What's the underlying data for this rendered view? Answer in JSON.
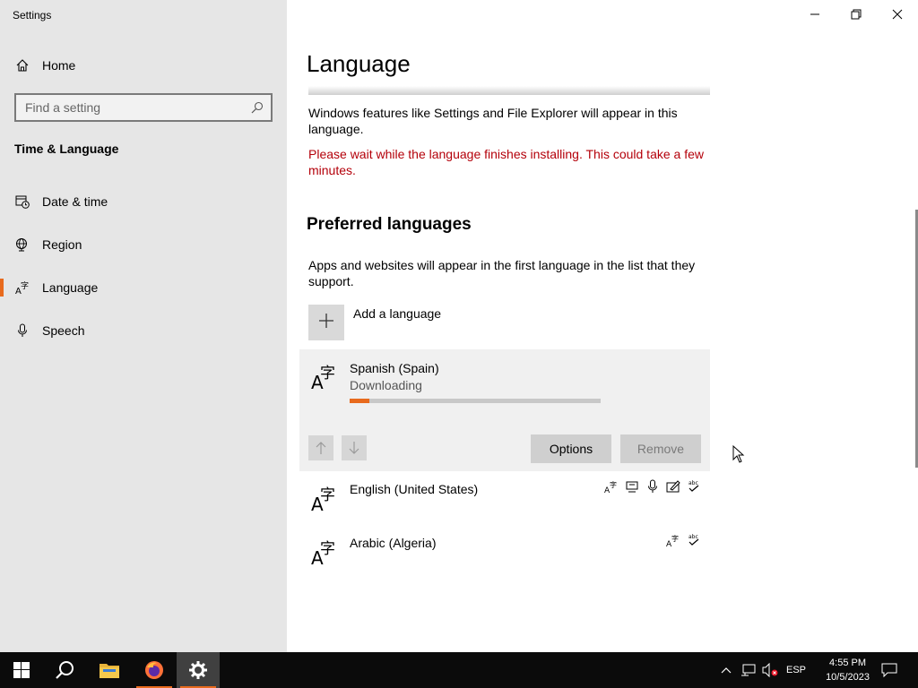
{
  "window": {
    "title": "Settings",
    "controls": [
      "minimize",
      "maximize",
      "close"
    ]
  },
  "sidebar": {
    "home_label": "Home",
    "search_placeholder": "Find a setting",
    "section_title": "Time & Language",
    "items": [
      {
        "label": "Date & time",
        "icon": "calendar-clock-icon"
      },
      {
        "label": "Region",
        "icon": "globe-icon"
      },
      {
        "label": "Language",
        "icon": "language-icon",
        "active": true
      },
      {
        "label": "Speech",
        "icon": "microphone-icon"
      }
    ]
  },
  "main": {
    "title": "Language",
    "display_language_text": "Windows features like Settings and File Explorer will appear in this language.",
    "warning_text": "Please wait while the language finishes installing. This could take a few minutes.",
    "preferred_heading": "Preferred languages",
    "preferred_description": "Apps and websites will appear in the first language in the list that they support.",
    "add_language_label": "Add a language",
    "languages": [
      {
        "name": "Spanish (Spain)",
        "status": "Downloading",
        "progress": 0.08,
        "selected": true
      },
      {
        "name": "English (United States)",
        "features": [
          "language-pack-icon",
          "text-to-speech-icon",
          "speech-recognition-icon",
          "handwriting-icon",
          "spellcheck-icon"
        ]
      },
      {
        "name": "Arabic (Algeria)",
        "features": [
          "language-pack-icon",
          "spellcheck-icon"
        ]
      }
    ],
    "options_label": "Options",
    "remove_label": "Remove"
  },
  "taskbar": {
    "apps": [
      "start-icon",
      "search-icon",
      "file-explorer-icon",
      "firefox-icon",
      "settings-icon"
    ],
    "input_language": "ESP",
    "time": "4:55 PM",
    "date": "10/5/2023"
  },
  "colors": {
    "accent": "#e86a1d",
    "warning": "#b4000a",
    "sidebar_bg": "#e6e6e6",
    "taskbar_bg": "#0b0b0b"
  }
}
